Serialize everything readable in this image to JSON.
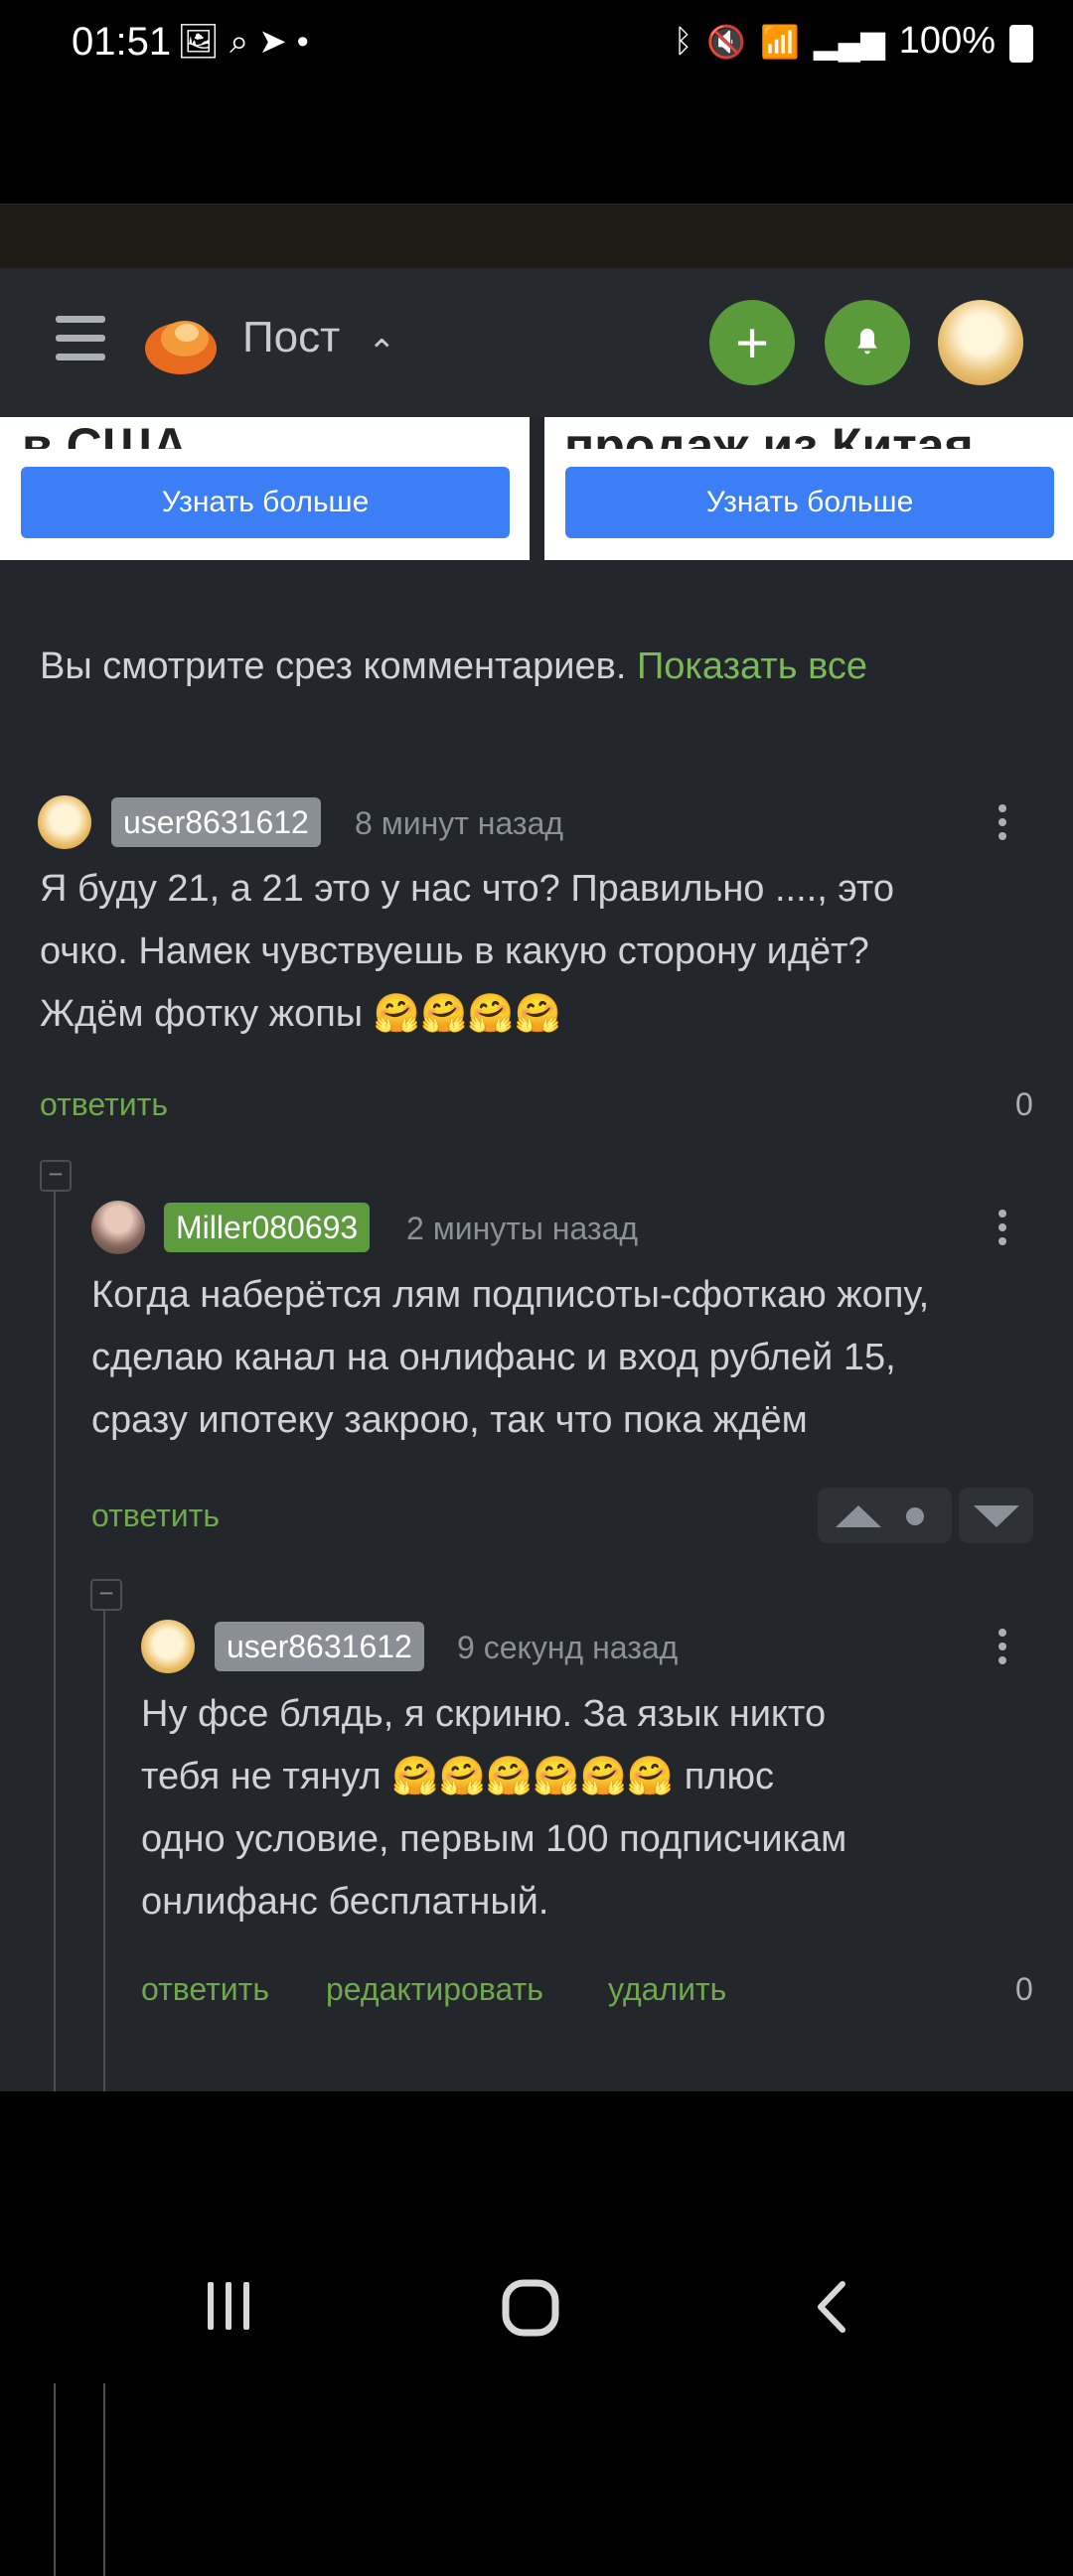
{
  "status_bar": {
    "time": "01:51",
    "left_icons": [
      "gallery-icon",
      "search-icon",
      "telegram-icon",
      "dot-icon"
    ],
    "battery": "100%"
  },
  "header": {
    "title": "Пост"
  },
  "ads": [
    {
      "headline": "в США",
      "button": "Узнать больше"
    },
    {
      "headline": "продаж из Китая",
      "button": "Узнать больше"
    }
  ],
  "slice_notice": {
    "text": "Вы смотрите срез комментариев.",
    "link": "Показать все"
  },
  "comments": [
    {
      "user": "user8631612",
      "badge_color": "#8a8f95",
      "time": "8 минут назад",
      "lines": [
        "Я буду 21, а 21 это у нас что? Правильно ...., это",
        "очко. Намек чувствуешь в какую сторону идёт?",
        "Ждём фотку жопы 🤗🤗🤗🤗"
      ],
      "reply": "ответить",
      "rating": "0"
    },
    {
      "user": "Miller080693",
      "badge_color": "#5e9a3e",
      "time": "2 минуты назад",
      "lines": [
        "Когда наберётся лям подписоты-сфоткаю жопу,",
        "сделаю канал на онлифанс и вход рублей 15,",
        "сразу ипотеку закрою, так что пока ждём"
      ],
      "reply": "ответить"
    },
    {
      "user": "user8631612",
      "badge_color": "#8a8f95",
      "time": "9 секунд назад",
      "lines": [
        "Ну фсе блядь, я скриню. За язык никто",
        "тебя не тянул 🤗🤗🤗🤗🤗🤗 плюс",
        "одно условие, первым 100 подписчикам",
        "онлифанс бесплатный."
      ],
      "reply": "ответить",
      "edit": "редактировать",
      "delete": "удалить",
      "rating": "0"
    }
  ],
  "colors": {
    "accent_green": "#6fa84e",
    "ad_button": "#3b7ef5",
    "background": "#23272b"
  }
}
